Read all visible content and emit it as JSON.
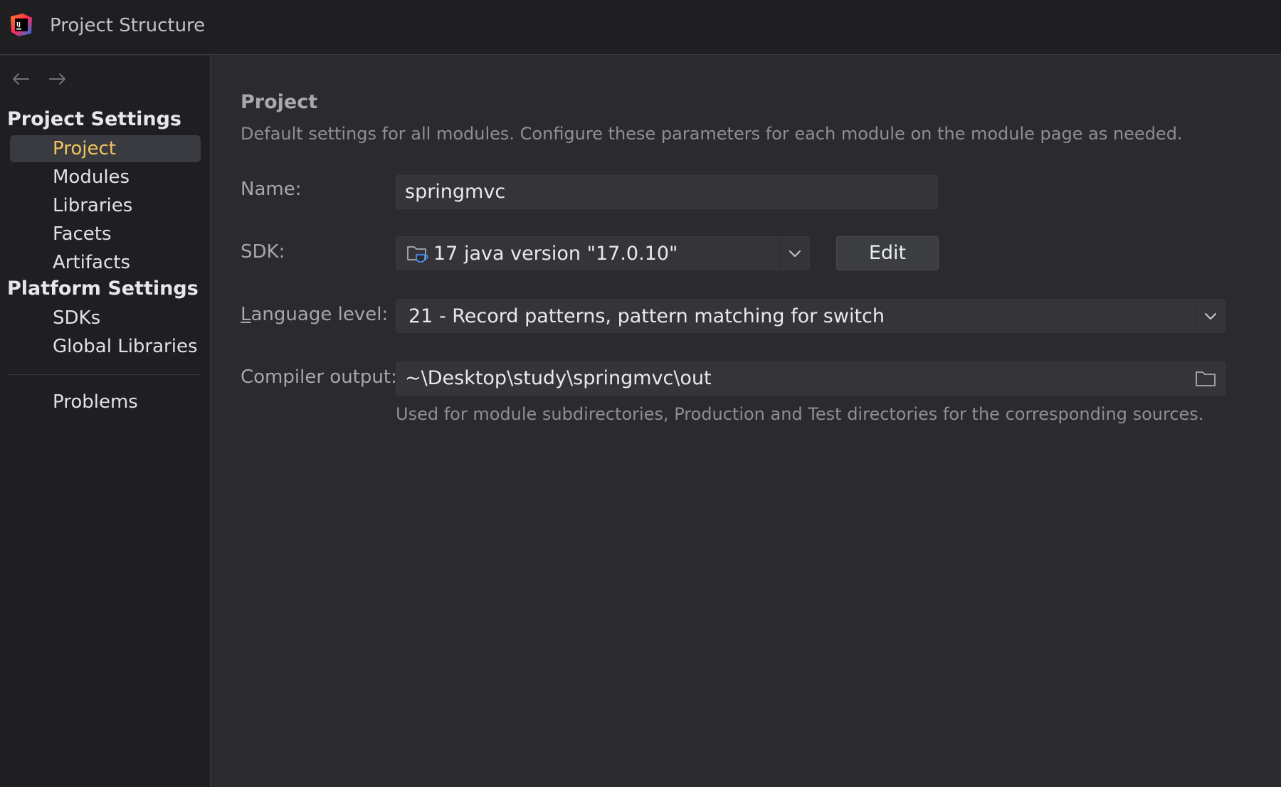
{
  "window": {
    "title": "Project Structure",
    "logo_icon": "intellij-idea-logo-icon"
  },
  "sidebar": {
    "project_settings_header": "Project Settings",
    "project_items": [
      {
        "label": "Project",
        "selected": true
      },
      {
        "label": "Modules",
        "selected": false
      },
      {
        "label": "Libraries",
        "selected": false
      },
      {
        "label": "Facets",
        "selected": false
      },
      {
        "label": "Artifacts",
        "selected": false
      }
    ],
    "platform_settings_header": "Platform Settings",
    "platform_items": [
      {
        "label": "SDKs"
      },
      {
        "label": "Global Libraries"
      }
    ],
    "problems_label": "Problems"
  },
  "main": {
    "heading": "Project",
    "description": "Default settings for all modules. Configure these parameters for each module on the module page as needed.",
    "name_label": "Name:",
    "name_value": "springmvc",
    "sdk_label": "SDK:",
    "sdk_value": "17 java version \"17.0.10\"",
    "edit_label": "Edit",
    "language_level_label_first": "L",
    "language_level_label_rest": "anguage level:",
    "language_level_value": "21 - Record patterns, pattern matching for switch",
    "compiler_output_label": "Compiler output:",
    "compiler_output_value": "~\\Desktop\\study\\springmvc\\out",
    "compiler_output_hint": "Used for module subdirectories, Production and Test directories for the corresponding sources."
  },
  "colors": {
    "accent_selected_text": "#f2c55c",
    "background": "#2b2b2f",
    "sidebar_background": "#1f1f22"
  }
}
